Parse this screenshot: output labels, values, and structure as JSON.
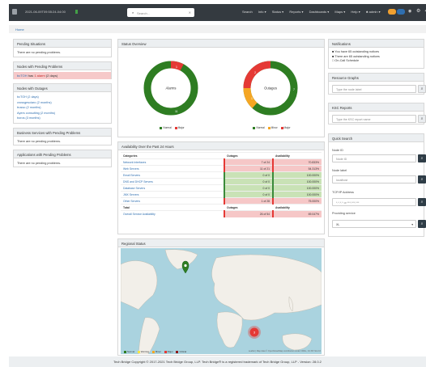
{
  "header": {
    "clock": "2021-06-09T09:55:24-04:00",
    "search_placeholder": "Search...",
    "nav": [
      "Search",
      "Info ▾",
      "Status ▾",
      "Reports ▾",
      "Dashboards ▾",
      "Maps ▾",
      "Help ▾",
      "♣ admin ▾"
    ],
    "icons": [
      "brand-icon",
      "search-icon",
      "clear-icon",
      "alarm-icon",
      "gear-icon",
      "share-icon"
    ],
    "colors": {
      "bar": "#343a40",
      "notice_badge": "#f0a030",
      "alarm_badge": "#2f6fb0"
    }
  },
  "breadcrumb": "Home",
  "left": {
    "pending_situations": {
      "title": "Pending Situations",
      "body": "There are no pending problems."
    },
    "nodes_pending": {
      "title": "Nodes with Pending Problems",
      "node": "bcTOH",
      "text_has": "has",
      "alarm": "1 alarm",
      "age": "(2 days)"
    },
    "nodes_outages": {
      "title": "Nodes with Outages",
      "items": [
        "bcTOH (2 days)",
        "crossgesciaro (2 months)",
        "trusso (2 months)",
        "Ayers consulting (2 months)",
        "boros (3 months)"
      ]
    },
    "business_services": {
      "title": "Business Services with Pending Problems",
      "body": "There are no pending problems."
    },
    "applications": {
      "title": "Applications with Pending Problems",
      "body": "There are no pending problems."
    }
  },
  "status_overview": {
    "title": "Status Overview",
    "alarms": {
      "center": "Alarms",
      "small": "1",
      "big": "11",
      "legend": [
        "Normal",
        "Major"
      ]
    },
    "outages": {
      "center": "Outages",
      "labels": [
        "2",
        "1",
        "7"
      ],
      "legend": [
        "Normal",
        "Minor",
        "Major"
      ]
    },
    "colors": {
      "normal": "#2e7d22",
      "minor": "#f5a623",
      "major": "#e53935"
    }
  },
  "availability": {
    "title": "Availability Over the Past 24 Hours",
    "headers": [
      "Categories",
      "Outages",
      "Availability"
    ],
    "rows": [
      {
        "name": "Network Interfaces",
        "outages": "7 of 24",
        "avail": "70.833%",
        "state": "bad"
      },
      {
        "name": "Web Servers",
        "outages": "11 of 21",
        "avail": "54.313%",
        "state": "bad"
      },
      {
        "name": "Email Servers",
        "outages": "0 of 0",
        "avail": "100.000%",
        "state": "good"
      },
      {
        "name": "DNS and DHCP Servers",
        "outages": "0 of 0",
        "avail": "100.000%",
        "state": "good"
      },
      {
        "name": "Database Servers",
        "outages": "0 of 0",
        "avail": "100.000%",
        "state": "good"
      },
      {
        "name": "JMX Servers",
        "outages": "0 of 0",
        "avail": "100.000%",
        "state": "good"
      },
      {
        "name": "Other Servers",
        "outages": "1 of 28",
        "avail": "75.000%",
        "state": "bad"
      }
    ],
    "total_headers": [
      "Total",
      "Outages",
      "Availability"
    ],
    "total": {
      "name": "Overall Service Availability",
      "outages": "26 of 54",
      "avail": "69.047%",
      "state": "bad"
    },
    "colors": {
      "good_bar": "#3b8a3b",
      "good_bg": "#c9e2b6",
      "bad_bar": "#e53935",
      "bad_bg": "#f6c7c7"
    }
  },
  "regional": {
    "title": "Regional Status",
    "marker_count": "3",
    "legend": [
      "Normal",
      "Warning",
      "Minor",
      "Major",
      "Critical"
    ],
    "attribution": "Leaflet | Map data © OpenStreetMap contributors under ODbL, CC BY-SA 2.0"
  },
  "right": {
    "notifications": {
      "title": "Notifications",
      "items": [
        "You have 65 outstanding notices",
        "There are 65 outstanding notices",
        "On-Call Schedule"
      ]
    },
    "resource_graphs": {
      "title": "Resource Graphs",
      "placeholder": "Type the node label"
    },
    "ksc_reports": {
      "title": "KSC Reports",
      "placeholder": "Type the KSC report name"
    },
    "quick_search": {
      "title": "Quick Search",
      "node_id_label": "Node ID",
      "node_id_ph": "Node ID",
      "node_label_label": "Node label",
      "node_label_ph": "localhost",
      "ip_label": "TCP/IP Address",
      "ip_ph": "*.*.*.* or ***.***.***",
      "service_label": "Providing service",
      "service_value": "XL"
    }
  },
  "footer": "Tech Bridge Copyright © 2017-2021 Tech Bridge Group, LLP. Tech Bridge® is a registered trademark of Tech Bridge Group, LLP - Version: 28.0.2"
}
